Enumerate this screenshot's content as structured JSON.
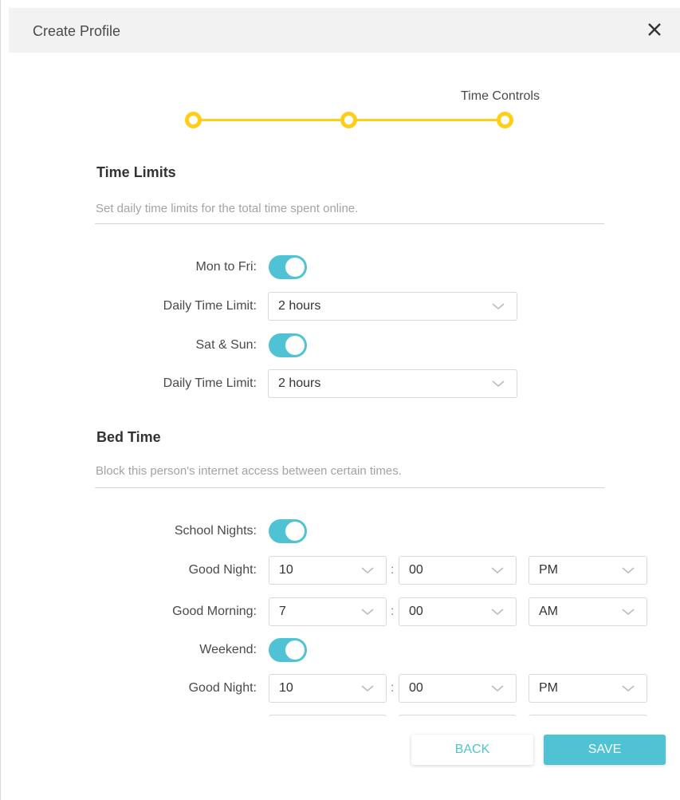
{
  "dialog": {
    "title": "Create Profile",
    "close_icon": "close-icon"
  },
  "stepper": {
    "current_step_label": "Time Controls",
    "color": "#ffce17",
    "steps_total": 3,
    "current_step": 3
  },
  "time_limits": {
    "title": "Time Limits",
    "description": "Set daily time limits for the total time spent online.",
    "weekdays": {
      "label": "Mon to Fri:",
      "enabled": true,
      "limit_label": "Daily Time Limit:",
      "limit_value": "2 hours"
    },
    "weekend": {
      "label": "Sat & Sun:",
      "enabled": true,
      "limit_label": "Daily Time Limit:",
      "limit_value": "2 hours"
    }
  },
  "bed_time": {
    "title": "Bed Time",
    "description": "Block this person's internet access between certain times.",
    "school_nights": {
      "label": "School Nights:",
      "enabled": true,
      "good_night": {
        "label": "Good Night:",
        "hour": "10",
        "minute": "00",
        "period": "PM"
      },
      "good_morning": {
        "label": "Good Morning:",
        "hour": "7",
        "minute": "00",
        "period": "AM"
      }
    },
    "weekend": {
      "label": "Weekend:",
      "enabled": true,
      "good_night": {
        "label": "Good Night:",
        "hour": "10",
        "minute": "00",
        "period": "PM"
      }
    },
    "separator": ":"
  },
  "buttons": {
    "back": "BACK",
    "save": "SAVE"
  },
  "colors": {
    "accent": "#4fc3d3",
    "header_bg": "#f2f2f2"
  }
}
